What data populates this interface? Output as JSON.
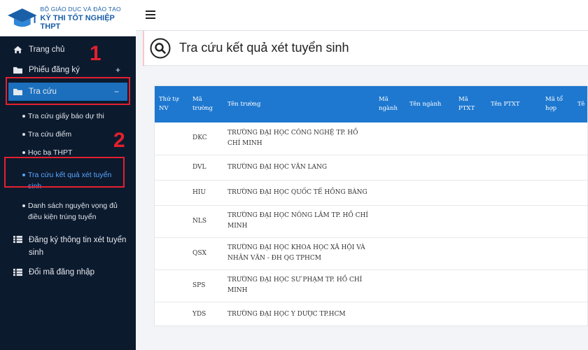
{
  "brand": {
    "line1": "BỘ GIÁO DỤC VÀ ĐÀO TẠO",
    "line2": "KỲ THI TỐT NGHIỆP THPT"
  },
  "sidebar": {
    "items": [
      {
        "label": "Trang chủ",
        "icon": "home-icon"
      },
      {
        "label": "Phiếu đăng ký",
        "icon": "folder-icon",
        "sign": "+"
      },
      {
        "label": "Tra cứu",
        "icon": "folder-icon",
        "sign": "−"
      },
      {
        "label": "Đăng ký thông tin xét tuyển sinh",
        "icon": "list-icon"
      },
      {
        "label": "Đổi mã đăng nhập",
        "icon": "list-icon"
      }
    ],
    "sub_items": [
      "Tra cứu giấy báo dự thi",
      "Tra cứu điểm",
      "Học bạ THPT",
      "Tra cứu kết quả xét tuyển sinh",
      "Danh sách nguyện vọng đủ điều kiện trúng tuyển"
    ]
  },
  "annotations": {
    "step1": "1",
    "step2": "2"
  },
  "page": {
    "title": "Tra cứu kết quả xét tuyển sinh"
  },
  "table": {
    "headers": [
      "Thứ tự NV",
      "Mã trường",
      "Tên trường",
      "Mã ngành",
      "Tên ngành",
      "Mã PTXT",
      "Tên PTXT",
      "Mã tổ hợp",
      "Tê"
    ],
    "rows": [
      {
        "code": "DKC",
        "name": "TRƯỜNG ĐẠI HỌC CÔNG NGHỆ TP. HỒ CHÍ MINH"
      },
      {
        "code": "DVL",
        "name": "TRƯỜNG ĐẠI HỌC VĂN LANG"
      },
      {
        "code": "HIU",
        "name": "TRƯỜNG ĐẠI HỌC QUỐC TẾ HỒNG BÀNG"
      },
      {
        "code": "NLS",
        "name": "TRƯỜNG ĐẠI HỌC NÔNG LÂM TP. HỒ CHÍ MINH"
      },
      {
        "code": "QSX",
        "name": "TRƯỜNG ĐẠI HỌC KHOA HỌC XÃ HỘI VÀ NHÂN VĂN - ĐH QG TPHCM"
      },
      {
        "code": "SPS",
        "name": "TRƯỜNG ĐẠI HỌC SƯ PHẠM TP. HỒ CHÍ MINH"
      },
      {
        "code": "YDS",
        "name": "TRƯỜNG ĐẠI HỌC Y DƯỢC TP.HCM"
      }
    ]
  },
  "colors": {
    "accent": "#1e78d0",
    "sidebar_bg": "#0c1a2e",
    "annotation": "#e4202e"
  }
}
